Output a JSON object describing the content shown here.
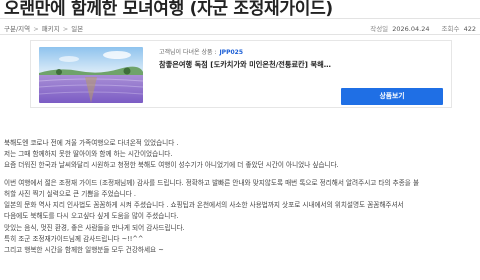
{
  "title": "오랜만에 함께한 모녀여행 (자군 조정재가이드)",
  "breadcrumb": [
    "구분/지역",
    "패키지",
    "일본"
  ],
  "meta": {
    "date_label": "작성일",
    "date": "2026.04.24",
    "views_label": "조회수",
    "views": "422"
  },
  "product": {
    "visited_label": "고객님이 다녀온 상품 :",
    "code": "JPP025",
    "title": "참좋은여행 독점 [도카치가와 미인온천/전통료칸] 북해도/비에이/후라노 4일_[모르온천...",
    "button": "상품보기"
  },
  "article": {
    "paragraphs": [
      [
        "북해도엔 코로나 전에 겨울 가족여행으로 다녀온적 있었습니다 .",
        "저는 그때 함께하지 못한 딸아이와 함께 하는 시간이었습니다.",
        "요즘 더워진 한국과 날씨와달리 시원하고 청정한 북해도 여행이 성수기가 아니었기에 더 좋았던 시간이 아니었나 싶습니다."
      ],
      [
        "이번 여행에서 젊은 조정재 가이드 (조정재님께) 감사를 드립니다. 정확하고 발빠른 안내와 맞지않도록 매번 톡으로 정리해서 알려주시고 타의 추종을 불",
        "허할 사진 찍기 실력으로 큰 기쁨을 주었습니다 .",
        "일본의 문화 역사 지리 인사법도 꼼꼼하게 시켜 주셨습니다 . 쇼핑팁과 온천에서의 사소한 사용법까지 삿포로 시내에서의 위치설명도 꼼꼼해주셔서",
        "다음에도 북해도를 다시 오고싶다 싶게 도움을 많이 주셨습니다.",
        "맛있는 음식, 멋진 환경, 좋은 사람들을 만나게 되어 감사드립니다.",
        "특히 조군 조정재가이드님께 감사드립니다 ~!!^^",
        "그리고 행복한 시간을 함께한 일행분들 모두 건강하세요 ~"
      ]
    ]
  },
  "colors": {
    "accent": "#1f6fe5",
    "code": "#1c5fd6",
    "text": "#444444"
  }
}
